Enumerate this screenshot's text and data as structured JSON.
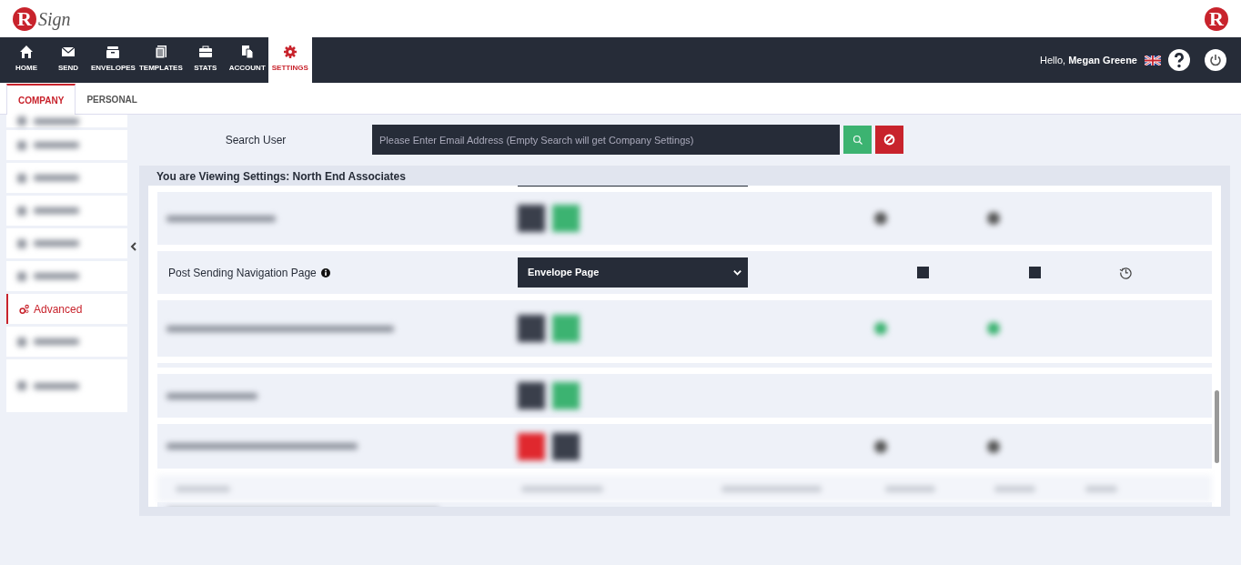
{
  "logo": {
    "mark": "R",
    "text": "Sign"
  },
  "brand_mark": "R",
  "nav": [
    {
      "label": "HOME",
      "kind": "home",
      "selected": false
    },
    {
      "label": "SEND",
      "kind": "send",
      "selected": false
    },
    {
      "label": "ENVELOPES",
      "kind": "envelopes",
      "selected": false
    },
    {
      "label": "TEMPLATES",
      "kind": "templates",
      "selected": false
    },
    {
      "label": "STATS",
      "kind": "stats",
      "selected": false
    },
    {
      "label": "ACCOUNT",
      "kind": "account",
      "selected": false
    },
    {
      "label": "SETTINGS",
      "kind": "settings",
      "selected": true
    }
  ],
  "user": {
    "greeting": "Hello,",
    "name": "Megan Greene"
  },
  "tabs": [
    {
      "label": "COMPANY",
      "selected": true
    },
    {
      "label": "PERSONAL",
      "selected": false
    }
  ],
  "sidebar": {
    "items": [
      {
        "label": "Advanced",
        "selected": true
      }
    ]
  },
  "search": {
    "label": "Search User",
    "placeholder": "Please Enter Email Address (Empty Search will get Company Settings)"
  },
  "panel": {
    "title": "You are Viewing Settings: North End Associates",
    "setting": {
      "label": "Post Sending Navigation Page",
      "value": "Envelope Page",
      "override_checked": true,
      "lock_checked": true
    }
  }
}
